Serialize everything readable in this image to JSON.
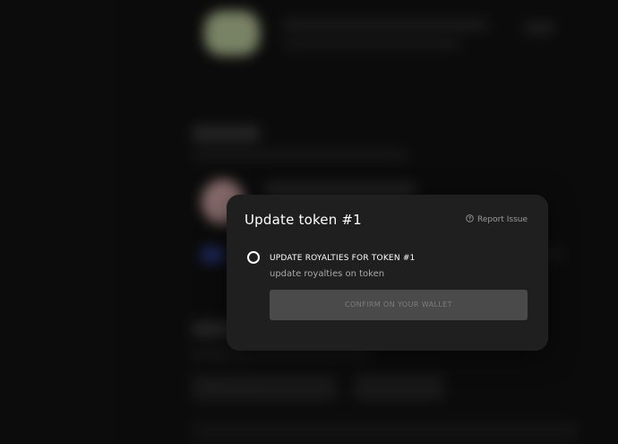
{
  "modal": {
    "title": "Update token #1",
    "report_label": "Report Issue",
    "report_icon": "question-circle-icon",
    "step": {
      "title": "UPDATE ROYALTIES FOR TOKEN #1",
      "subtitle": "update royalties on token",
      "button_label": "CONFIRM ON YOUR WALLET"
    }
  },
  "colors": {
    "background": "#121212",
    "modal": "#1f1f1f",
    "button": "#4a4a4a",
    "text": "#ffffff",
    "muted": "#a8a8a8"
  }
}
